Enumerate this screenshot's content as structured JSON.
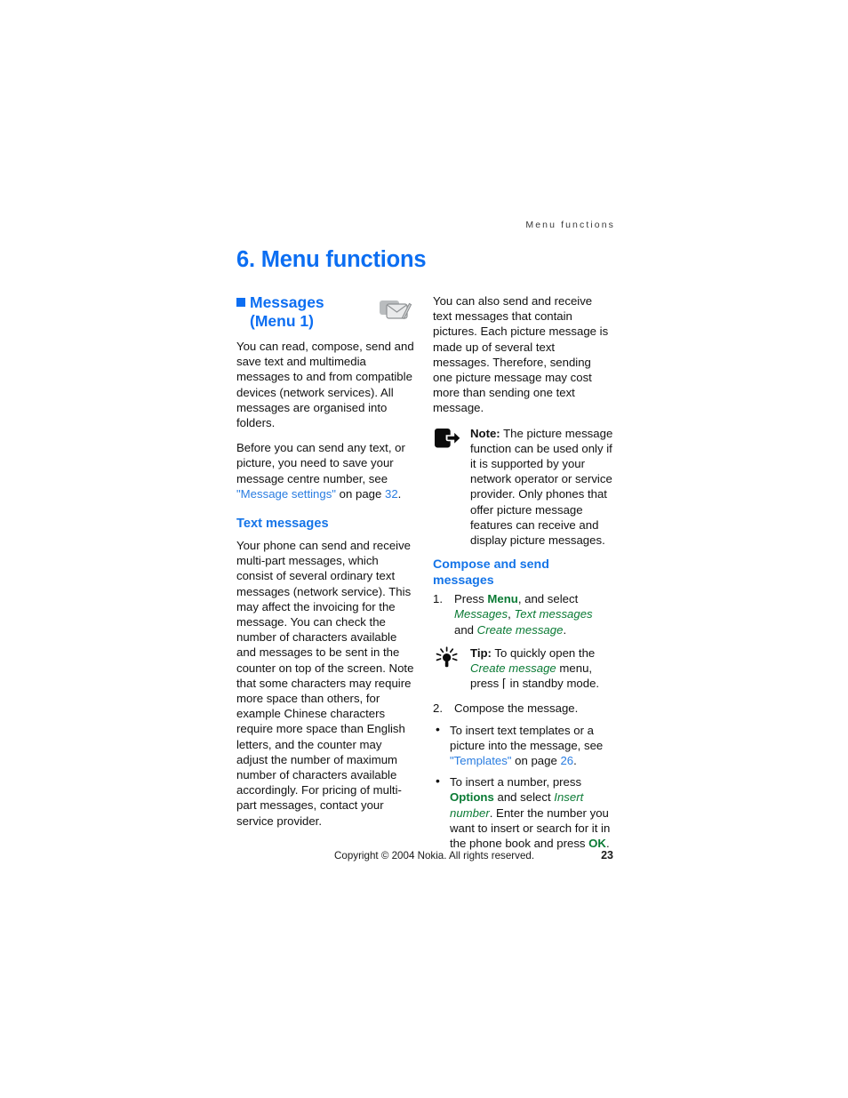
{
  "document": {
    "running_head": "Menu functions",
    "chapter_title": "6. Menu functions"
  },
  "left_column": {
    "section": {
      "icon": "messages-envelope-icon",
      "title_line1": "Messages",
      "title_line2": "(Menu 1)"
    },
    "paragraph_1": "You can read, compose, send and save text and multimedia messages to and from compatible devices (network services). All messages are organised into folders.",
    "paragraph_2_part1": "Before you can send any text, or picture, you need to save your message centre number, see ",
    "paragraph_2_link": "\"Message settings\"",
    "paragraph_2_part2": " on page ",
    "paragraph_2_page": "32",
    "paragraph_2_part3": ".",
    "subhead_text_messages": "Text messages",
    "paragraph_3": "Your phone can send and receive multi-part messages, which consist of several ordinary text messages (network service). This may affect the invoicing for the message. You can check the number of characters available and messages to be sent in the counter on top of the screen. Note that some characters may require more space than others, for example Chinese characters require more space than English letters, and the counter may adjust the number of maximum number of characters available accordingly. For pricing of multi-part messages, contact your service provider."
  },
  "right_column": {
    "paragraph_1": "You can also send and receive text messages that contain pictures. Each picture message is made up of several text messages. Therefore, sending one picture message may cost more than sending one text message.",
    "note": {
      "icon": "note-arrow-icon",
      "label": "Note:",
      "text": " The picture message function can be used only if it is supported by your network operator or service provider. Only phones that offer picture message features can receive and display picture messages."
    },
    "subhead_compose": "Compose and send messages",
    "step1": {
      "number": "1.",
      "part1": "Press ",
      "bold_menu": "Menu",
      "part2": ", and select ",
      "italic_messages": "Messages",
      "part3": ", ",
      "italic_text_messages": "Text messages",
      "part4": " and ",
      "italic_create_message": "Create message",
      "part5": "."
    },
    "tip": {
      "icon": "lightbulb-tip-icon",
      "label": "Tip:",
      "part1": " To quickly open the ",
      "italic_create_message": "Create message",
      "part2": " menu, press ",
      "softkey_glyph": "⌈",
      "part3": " in standby mode."
    },
    "step2": {
      "number": "2.",
      "text": "Compose the message."
    },
    "bullet1": {
      "marker": "•",
      "part1": "To insert text templates or a picture into the message, see ",
      "link": "\"Templates\"",
      "part2": " on page ",
      "page": "26",
      "part3": "."
    },
    "bullet2": {
      "marker": "•",
      "part1": "To insert a number, press ",
      "bold_options": "Options",
      "part2": " and select ",
      "italic_insert_number": "Insert number",
      "part3": ". Enter the number you want to insert or search for it in the phone book and press ",
      "bold_ok": "OK",
      "part4": "."
    }
  },
  "footer": {
    "copyright": "Copyright © 2004 Nokia. All rights reserved.",
    "page_number": "23"
  },
  "colors": {
    "heading_blue": "#0c6ef2",
    "link_blue": "#2a7de1",
    "menu_green": "#0a7a34",
    "body_black": "#111111"
  }
}
